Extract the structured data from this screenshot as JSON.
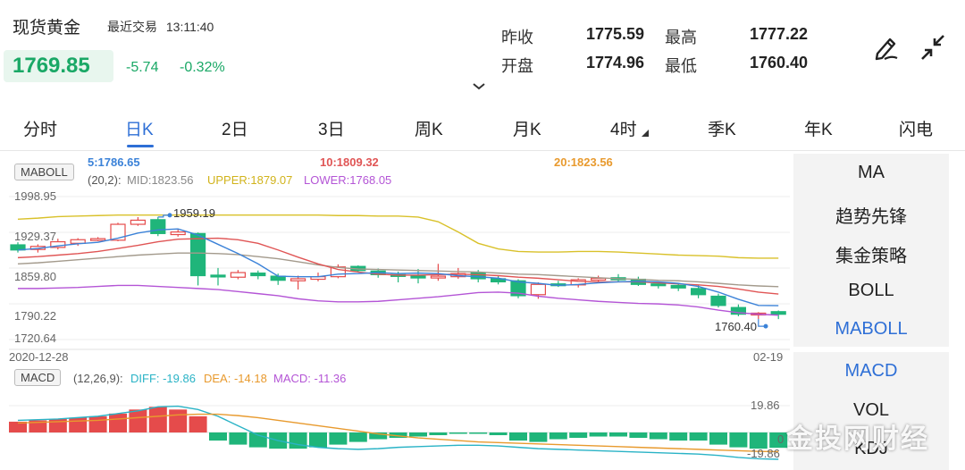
{
  "header": {
    "title": "现货黄金",
    "last_trade_label": "最近交易",
    "last_trade_time": "13:11:40",
    "price": "1769.85",
    "change": "-5.74",
    "change_pct": "-0.32%",
    "stats": {
      "prev_close_label": "昨收",
      "prev_close": "1775.59",
      "high_label": "最高",
      "high": "1777.22",
      "open_label": "开盘",
      "open": "1774.96",
      "low_label": "最低",
      "low": "1760.40"
    },
    "icons": [
      "edit-pen-icon",
      "collapse-icon",
      "chevron-down-icon"
    ]
  },
  "tabs": [
    {
      "label": "分时"
    },
    {
      "label": "日K",
      "active": true
    },
    {
      "label": "2日"
    },
    {
      "label": "3日"
    },
    {
      "label": "周K"
    },
    {
      "label": "月K"
    },
    {
      "label": "4时"
    },
    {
      "label": "季K"
    },
    {
      "label": "年K"
    },
    {
      "label": "闪电"
    }
  ],
  "main_chart": {
    "indicator": "MABOLL",
    "ma5": "5:1786.65",
    "ma10": "10:1809.32",
    "ma20": "20:1823.56",
    "boll_params": "(20,2):",
    "mid": "MID:1823.56",
    "upper": "UPPER:1879.07",
    "lower": "LOWER:1768.05",
    "y_ticks": [
      "1998.95",
      "1929.37",
      "1859.80",
      "1790.22",
      "1720.64"
    ],
    "high_mark": "1959.19",
    "low_mark": "1760.40",
    "date_start": "2020-12-28",
    "date_end": "02-19"
  },
  "macd_chart": {
    "indicator": "MACD",
    "params": "(12,26,9):",
    "diff": "DIFF: -19.86",
    "dea": "DEA: -14.18",
    "macd": "MACD: -11.36",
    "y_top": "19.86",
    "y_zero": "0",
    "y_bottom": "-19.86"
  },
  "side_main": [
    {
      "label": "MA"
    },
    {
      "label": "趋势先锋"
    },
    {
      "label": "集金策略"
    },
    {
      "label": "BOLL"
    },
    {
      "label": "MABOLL",
      "active": true
    }
  ],
  "side_sub": [
    {
      "label": "MACD",
      "active": true
    },
    {
      "label": "VOL"
    },
    {
      "label": "KDJ"
    }
  ],
  "watermark": "金投网财经",
  "colors": {
    "up": "#e54b4b",
    "down": "#1fb57a",
    "accent": "#2e6fd6",
    "ma5": "#3b82d8",
    "ma10": "#e05555",
    "ma20": "#e89a2e",
    "upper": "#d9c12a",
    "lower": "#b455d6",
    "mid": "#a39a8c"
  },
  "chart_data": [
    {
      "type": "candlestick",
      "series_names": [
        "MA5",
        "MA10",
        "MA20",
        "MID",
        "UPPER",
        "LOWER"
      ],
      "candles": [
        {
          "o": 1905,
          "c": 1895,
          "h": 1910,
          "l": 1890
        },
        {
          "o": 1896,
          "c": 1902,
          "h": 1906,
          "l": 1890
        },
        {
          "o": 1900,
          "c": 1911,
          "h": 1917,
          "l": 1896
        },
        {
          "o": 1908,
          "c": 1915,
          "h": 1918,
          "l": 1903
        },
        {
          "o": 1915,
          "c": 1917,
          "h": 1920,
          "l": 1912
        },
        {
          "o": 1914,
          "c": 1945,
          "h": 1948,
          "l": 1912
        },
        {
          "o": 1945,
          "c": 1953,
          "h": 1959,
          "l": 1942
        },
        {
          "o": 1954,
          "c": 1927,
          "h": 1959.19,
          "l": 1922
        },
        {
          "o": 1925,
          "c": 1930,
          "h": 1935,
          "l": 1921
        },
        {
          "o": 1927,
          "c": 1845,
          "h": 1929,
          "l": 1826
        },
        {
          "o": 1846,
          "c": 1843,
          "h": 1860,
          "l": 1826
        },
        {
          "o": 1842,
          "c": 1851,
          "h": 1856,
          "l": 1838
        },
        {
          "o": 1850,
          "c": 1845,
          "h": 1855,
          "l": 1838
        },
        {
          "o": 1844,
          "c": 1836,
          "h": 1849,
          "l": 1827
        },
        {
          "o": 1835,
          "c": 1839,
          "h": 1845,
          "l": 1818
        },
        {
          "o": 1838,
          "c": 1843,
          "h": 1851,
          "l": 1834
        },
        {
          "o": 1843,
          "c": 1862,
          "h": 1867,
          "l": 1840
        },
        {
          "o": 1863,
          "c": 1855,
          "h": 1865,
          "l": 1851
        },
        {
          "o": 1854,
          "c": 1847,
          "h": 1859,
          "l": 1841
        },
        {
          "o": 1847,
          "c": 1845,
          "h": 1853,
          "l": 1832
        },
        {
          "o": 1844,
          "c": 1842,
          "h": 1858,
          "l": 1830
        },
        {
          "o": 1842,
          "c": 1844,
          "h": 1868,
          "l": 1835
        },
        {
          "o": 1843,
          "c": 1849,
          "h": 1860,
          "l": 1839
        },
        {
          "o": 1851,
          "c": 1839,
          "h": 1856,
          "l": 1832
        },
        {
          "o": 1839,
          "c": 1833,
          "h": 1845,
          "l": 1828
        },
        {
          "o": 1835,
          "c": 1806,
          "h": 1838,
          "l": 1801
        },
        {
          "o": 1808,
          "c": 1828,
          "h": 1832,
          "l": 1800
        },
        {
          "o": 1829,
          "c": 1827,
          "h": 1835,
          "l": 1823
        },
        {
          "o": 1827,
          "c": 1837,
          "h": 1840,
          "l": 1822
        },
        {
          "o": 1838,
          "c": 1840,
          "h": 1845,
          "l": 1832
        },
        {
          "o": 1841,
          "c": 1837,
          "h": 1848,
          "l": 1833
        },
        {
          "o": 1838,
          "c": 1828,
          "h": 1843,
          "l": 1825
        },
        {
          "o": 1829,
          "c": 1827,
          "h": 1833,
          "l": 1820
        },
        {
          "o": 1826,
          "c": 1821,
          "h": 1830,
          "l": 1815
        },
        {
          "o": 1820,
          "c": 1808,
          "h": 1826,
          "l": 1801
        },
        {
          "o": 1805,
          "c": 1787,
          "h": 1810,
          "l": 1783
        },
        {
          "o": 1783,
          "c": 1770,
          "h": 1789,
          "l": 1766
        },
        {
          "o": 1769,
          "c": 1772,
          "h": 1774,
          "l": 1760.4
        },
        {
          "o": 1774.96,
          "c": 1769.85,
          "h": 1777.22,
          "l": 1760.4
        }
      ],
      "ma5": [
        1895,
        1898,
        1903,
        1907,
        1910,
        1918,
        1928,
        1934,
        1936,
        1924,
        1906,
        1888,
        1868,
        1844,
        1843,
        1843,
        1848,
        1849,
        1851,
        1849,
        1850,
        1849,
        1845,
        1843,
        1840,
        1833,
        1830,
        1826,
        1828,
        1831,
        1833,
        1834,
        1833,
        1830,
        1824,
        1813,
        1799,
        1787,
        1786.65
      ],
      "ma10": [
        1880,
        1882,
        1885,
        1888,
        1892,
        1898,
        1904,
        1911,
        1916,
        1917,
        1918,
        1915,
        1908,
        1895,
        1881,
        1868,
        1857,
        1852,
        1848,
        1846,
        1846,
        1847,
        1848,
        1847,
        1845,
        1842,
        1840,
        1837,
        1834,
        1833,
        1833,
        1833,
        1831,
        1829,
        1827,
        1824,
        1819,
        1813,
        1809.32
      ],
      "ma20": [
        1868,
        1870,
        1873,
        1876,
        1879,
        1882,
        1885,
        1887,
        1889,
        1889,
        1888,
        1886,
        1882,
        1878,
        1872,
        1866,
        1861,
        1858,
        1857,
        1856,
        1855,
        1854,
        1853,
        1852,
        1850,
        1848,
        1847,
        1845,
        1843,
        1841,
        1839,
        1838,
        1836,
        1835,
        1833,
        1830,
        1827,
        1825,
        1823.56
      ],
      "upper": [
        1955,
        1957,
        1960,
        1961,
        1962,
        1963,
        1963,
        1963,
        1963,
        1963,
        1963,
        1963,
        1963,
        1963,
        1963,
        1963,
        1962,
        1962,
        1961,
        1961,
        1959,
        1950,
        1930,
        1908,
        1897,
        1892,
        1891,
        1891,
        1892,
        1892,
        1891,
        1889,
        1887,
        1885,
        1884,
        1883,
        1880,
        1879,
        1879.07
      ],
      "lower": [
        1820,
        1820,
        1821,
        1822,
        1824,
        1826,
        1826,
        1824,
        1822,
        1820,
        1818,
        1814,
        1810,
        1806,
        1800,
        1796,
        1794,
        1794,
        1795,
        1798,
        1801,
        1804,
        1808,
        1812,
        1813,
        1811,
        1805,
        1801,
        1798,
        1795,
        1793,
        1791,
        1790,
        1788,
        1784,
        1778,
        1773,
        1770,
        1768.05
      ],
      "y_range": [
        1720.64,
        1998.95
      ]
    },
    {
      "type": "bar",
      "name": "MACD",
      "series_names": [
        "DIFF",
        "DEA",
        "MACD"
      ],
      "macd": [
        8,
        9,
        10,
        11,
        12,
        14,
        17,
        19,
        17,
        12,
        -6,
        -9,
        -11,
        -12,
        -12,
        -11,
        -9,
        -7,
        -5,
        -4,
        -3,
        -2,
        -1,
        -1,
        -2,
        -6,
        -7,
        -5,
        -4,
        -3,
        -3,
        -4,
        -5,
        -6,
        -6,
        -9,
        -11,
        -12,
        -11.36
      ],
      "diff": [
        9,
        9.5,
        10,
        11,
        12,
        14,
        16,
        19,
        19.5,
        17,
        12,
        5,
        -2,
        -6,
        -9,
        -11,
        -12,
        -12.5,
        -12,
        -11,
        -10.5,
        -10,
        -9.5,
        -9.5,
        -10,
        -11,
        -12,
        -12.5,
        -13,
        -13.5,
        -14,
        -14.5,
        -15,
        -15.5,
        -16,
        -17,
        -18.5,
        -19.5,
        -19.86
      ],
      "dea": [
        7,
        7.5,
        8,
        8.5,
        9,
        10,
        11,
        12,
        13,
        13.5,
        13.5,
        12.5,
        11,
        9,
        7,
        5,
        3,
        1,
        -1,
        -2.5,
        -4,
        -5,
        -6,
        -7,
        -7.5,
        -8,
        -8.5,
        -9,
        -9.5,
        -10,
        -10.5,
        -11,
        -11.5,
        -12,
        -12.5,
        -13,
        -13.5,
        -14,
        -14.18
      ],
      "y_range": [
        -19.86,
        19.86
      ]
    }
  ]
}
